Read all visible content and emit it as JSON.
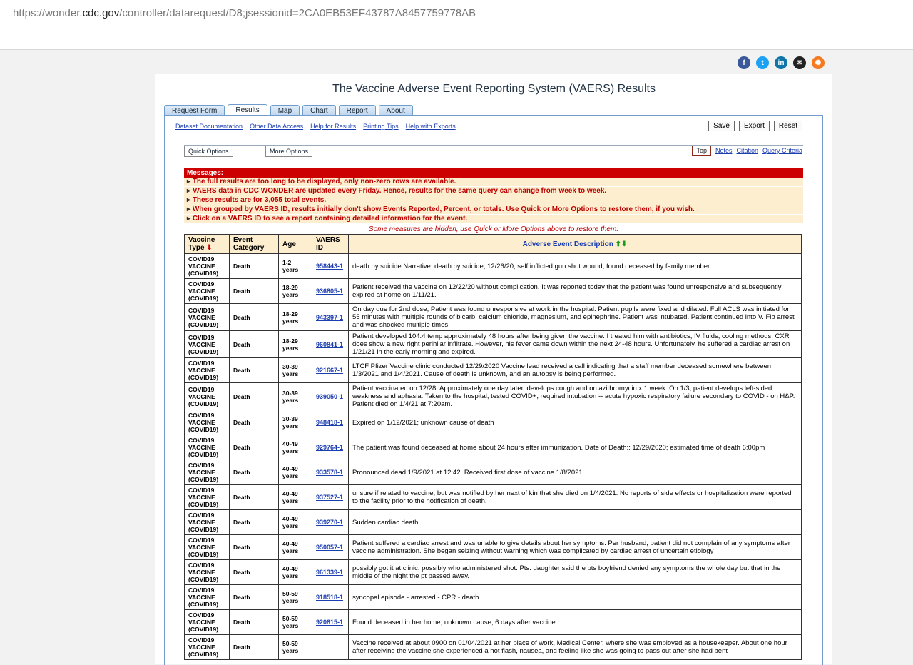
{
  "browser": {
    "url_prefix": "https://wonder.",
    "url_host": "cdc.gov",
    "url_path": "/controller/datarequest/D8;jsessionid=2CA0EB53EF43787A8457759778AB"
  },
  "share_icons": [
    "facebook-icon",
    "twitter-icon",
    "linkedin-icon",
    "email-icon",
    "syndication-icon"
  ],
  "title": "The Vaccine Adverse Event Reporting System (VAERS) Results",
  "tabs": [
    "Request Form",
    "Results",
    "Map",
    "Chart",
    "Report",
    "About"
  ],
  "toplinks": [
    "Dataset Documentation",
    "Other Data Access",
    "Help for Results",
    "Printing Tips",
    "Help with Exports"
  ],
  "buttons": {
    "save": "Save",
    "export": "Export",
    "reset": "Reset"
  },
  "options": {
    "quick": "Quick Options",
    "more": "More Options"
  },
  "rlinks": {
    "top": "Top",
    "notes": "Notes",
    "citation": "Citation",
    "query": "Query Criteria"
  },
  "messages": {
    "head": "Messages:",
    "items": [
      "The full results are too long to be displayed, only non-zero rows are available.",
      "VAERS data in CDC WONDER are updated every Friday. Hence, results for the same query can change from week to week.",
      "These results are for 3,055 total events.",
      "When grouped by VAERS ID, results initially don't show Events Reported, Percent, or totals. Use Quick or More Options to restore them, if you wish.",
      "Click on a VAERS ID to see a report containing detailed information for the event."
    ]
  },
  "hidden_note": "Some measures are hidden, use Quick or More Options above to restore them.",
  "table": {
    "headers": {
      "vt": "Vaccine Type",
      "ev": "Event Category",
      "age": "Age",
      "id": "VAERS ID",
      "desc": "Adverse Event Description"
    },
    "rows": [
      {
        "vt": "COVID19 VACCINE (COVID19)",
        "ev": "Death",
        "age": "1-2 years",
        "id": "958443-1",
        "desc": "death by suicide Narrative: death by suicide; 12/26/20, self inflicted gun shot wound; found deceased by family member"
      },
      {
        "vt": "COVID19 VACCINE (COVID19)",
        "ev": "Death",
        "age": "18-29 years",
        "id": "936805-1",
        "desc": "Patient received the vaccine on 12/22/20 without complication. It was reported today that the patient was found unresponsive and subsequently expired at home on 1/11/21."
      },
      {
        "vt": "COVID19 VACCINE (COVID19)",
        "ev": "Death",
        "age": "18-29 years",
        "id": "943397-1",
        "desc": "On day due for 2nd dose, Patient was found unresponsive at work in the hospital. Patient pupils were fixed and dilated. Full ACLS was initiated for 55 minutes with multiple rounds of bicarb, calcium chloride, magnesium, and epinephrine. Patient was intubated. Patient continued into V. Fib arrest and was shocked multiple times."
      },
      {
        "vt": "COVID19 VACCINE (COVID19)",
        "ev": "Death",
        "age": "18-29 years",
        "id": "960841-1",
        "desc": "Patient developed 104.4 temp approximately 48 hours after being given the vaccine. I treated him with antibiotics, IV fluids, cooling methods. CXR does show a new right perihilar infiltrate. However, his fever came down within the next 24-48 hours. Unfortunately, he suffered a cardiac arrest on 1/21/21 in the early morning and expired."
      },
      {
        "vt": "COVID19 VACCINE (COVID19)",
        "ev": "Death",
        "age": "30-39 years",
        "id": "921667-1",
        "desc": "LTCF Pfizer Vaccine clinic conducted 12/29/2020 Vaccine lead received a call indicating that a staff member deceased somewhere between 1/3/2021 and 1/4/2021. Cause of death is unknown, and an autopsy is being performed."
      },
      {
        "vt": "COVID19 VACCINE (COVID19)",
        "ev": "Death",
        "age": "30-39 years",
        "id": "939050-1",
        "desc": "Patient vaccinated on 12/28. Approximately one day later, develops cough and on azithromycin x 1 week. On 1/3, patient develops left-sided weakness and aphasia. Taken to the hospital, tested COVID+, required intubation -- acute hypoxic respiratory failure secondary to COVID - on H&P. Patient died on 1/4/21 at 7:20am."
      },
      {
        "vt": "COVID19 VACCINE (COVID19)",
        "ev": "Death",
        "age": "30-39 years",
        "id": "948418-1",
        "desc": "Expired on 1/12/2021; unknown cause of death"
      },
      {
        "vt": "COVID19 VACCINE (COVID19)",
        "ev": "Death",
        "age": "40-49 years",
        "id": "929764-1",
        "desc": "The patient was found deceased at home about 24 hours after immunization. Date of Death:: 12/29/2020; estimated time of death 6:00pm"
      },
      {
        "vt": "COVID19 VACCINE (COVID19)",
        "ev": "Death",
        "age": "40-49 years",
        "id": "933578-1",
        "desc": "Pronounced dead 1/9/2021 at 12:42. Received first dose of vaccine 1/8/2021"
      },
      {
        "vt": "COVID19 VACCINE (COVID19)",
        "ev": "Death",
        "age": "40-49 years",
        "id": "937527-1",
        "desc": "unsure if related to vaccine, but was notified by her next of kin that she died on 1/4/2021. No reports of side effects or hospitalization were reported to the facility prior to the notification of death."
      },
      {
        "vt": "COVID19 VACCINE (COVID19)",
        "ev": "Death",
        "age": "40-49 years",
        "id": "939270-1",
        "desc": "Sudden cardiac death"
      },
      {
        "vt": "COVID19 VACCINE (COVID19)",
        "ev": "Death",
        "age": "40-49 years",
        "id": "950057-1",
        "desc": "Patient suffered a cardiac arrest and was unable to give details about her symptoms. Per husband, patient did not complain of any symptoms after vaccine administration. She began seizing without warning which was complicated by cardiac arrest of uncertain etiology"
      },
      {
        "vt": "COVID19 VACCINE (COVID19)",
        "ev": "Death",
        "age": "40-49 years",
        "id": "961339-1",
        "desc": "possibly got it at clinic, possibly who administered shot. Pts. daughter said the pts boyfriend denied any symptoms the whole day but that in the middle of the night the pt passed away."
      },
      {
        "vt": "COVID19 VACCINE (COVID19)",
        "ev": "Death",
        "age": "50-59 years",
        "id": "918518-1",
        "desc": "syncopal episode - arrested - CPR - death"
      },
      {
        "vt": "COVID19 VACCINE (COVID19)",
        "ev": "Death",
        "age": "50-59 years",
        "id": "920815-1",
        "desc": "Found deceased in her home, unknown cause, 6 days after vaccine."
      },
      {
        "vt": "COVID19 VACCINE (COVID19)",
        "ev": "Death",
        "age": "50-59 years",
        "id": "",
        "desc": "Vaccine received at about 0900 on 01/04/2021 at her place of work, Medical Center, where she was employed as a housekeeper. About one hour after receiving the vaccine she experienced a hot flash, nausea, and feeling like she was going to pass out after she had bent"
      }
    ]
  }
}
